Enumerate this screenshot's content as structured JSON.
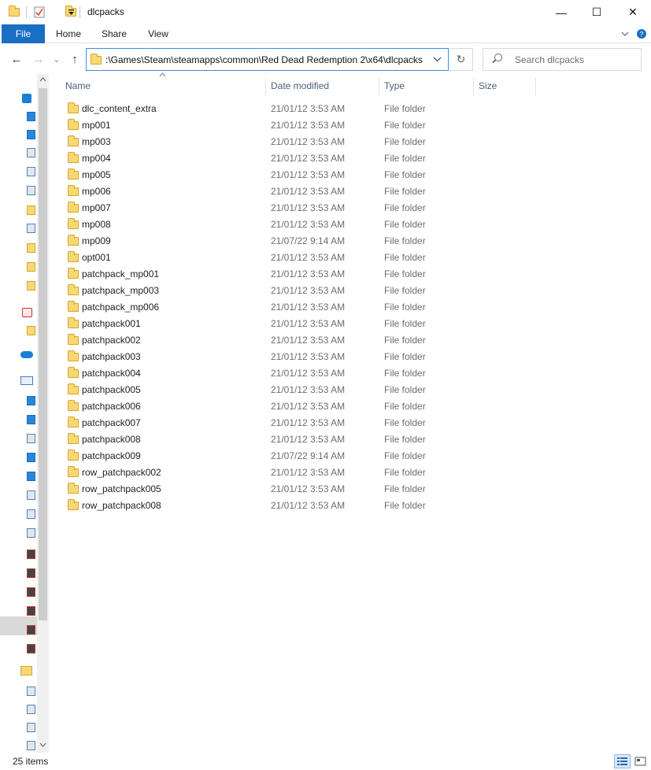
{
  "window": {
    "title": "dlcpacks",
    "controls": {
      "minimize": "—",
      "maximize": "☐",
      "close": "✕"
    }
  },
  "ribbon": {
    "tabs": [
      {
        "label": "File",
        "active": true
      },
      {
        "label": "Home"
      },
      {
        "label": "Share"
      },
      {
        "label": "View"
      }
    ],
    "expand_icon": "chevron-down-icon",
    "help_icon": "help-icon"
  },
  "navigation": {
    "back": "←",
    "forward": "→",
    "recent": "⌄",
    "up": "↑",
    "address_path": ":\\Games\\Steam\\steamapps\\common\\Red Dead Redemption 2\\x64\\dlcpacks",
    "refresh": "↻",
    "search_placeholder": "Search dlcpacks"
  },
  "columns": {
    "name": "Name",
    "date": "Date modified",
    "type": "Type",
    "size": "Size",
    "sorted_by": "Name"
  },
  "files": [
    {
      "name": "dlc_content_extra",
      "date": "21/01/12 3:53 AM",
      "type": "File folder"
    },
    {
      "name": "mp001",
      "date": "21/01/12 3:53 AM",
      "type": "File folder"
    },
    {
      "name": "mp003",
      "date": "21/01/12 3:53 AM",
      "type": "File folder"
    },
    {
      "name": "mp004",
      "date": "21/01/12 3:53 AM",
      "type": "File folder"
    },
    {
      "name": "mp005",
      "date": "21/01/12 3:53 AM",
      "type": "File folder"
    },
    {
      "name": "mp006",
      "date": "21/01/12 3:53 AM",
      "type": "File folder"
    },
    {
      "name": "mp007",
      "date": "21/01/12 3:53 AM",
      "type": "File folder"
    },
    {
      "name": "mp008",
      "date": "21/01/12 3:53 AM",
      "type": "File folder"
    },
    {
      "name": "mp009",
      "date": "21/07/22 9:14 AM",
      "type": "File folder"
    },
    {
      "name": "opt001",
      "date": "21/01/12 3:53 AM",
      "type": "File folder"
    },
    {
      "name": "patchpack_mp001",
      "date": "21/01/12 3:53 AM",
      "type": "File folder"
    },
    {
      "name": "patchpack_mp003",
      "date": "21/01/12 3:53 AM",
      "type": "File folder"
    },
    {
      "name": "patchpack_mp006",
      "date": "21/01/12 3:53 AM",
      "type": "File folder"
    },
    {
      "name": "patchpack001",
      "date": "21/01/12 3:53 AM",
      "type": "File folder"
    },
    {
      "name": "patchpack002",
      "date": "21/01/12 3:53 AM",
      "type": "File folder"
    },
    {
      "name": "patchpack003",
      "date": "21/01/12 3:53 AM",
      "type": "File folder"
    },
    {
      "name": "patchpack004",
      "date": "21/01/12 3:53 AM",
      "type": "File folder"
    },
    {
      "name": "patchpack005",
      "date": "21/01/12 3:53 AM",
      "type": "File folder"
    },
    {
      "name": "patchpack006",
      "date": "21/01/12 3:53 AM",
      "type": "File folder"
    },
    {
      "name": "patchpack007",
      "date": "21/01/12 3:53 AM",
      "type": "File folder"
    },
    {
      "name": "patchpack008",
      "date": "21/01/12 3:53 AM",
      "type": "File folder"
    },
    {
      "name": "patchpack009",
      "date": "21/07/22 9:14 AM",
      "type": "File folder"
    },
    {
      "name": "row_patchpack002",
      "date": "21/01/12 3:53 AM",
      "type": "File folder"
    },
    {
      "name": "row_patchpack005",
      "date": "21/01/12 3:53 AM",
      "type": "File folder"
    },
    {
      "name": "row_patchpack008",
      "date": "21/01/12 3:53 AM",
      "type": "File folder"
    }
  ],
  "status": {
    "item_count": "25 items",
    "view_modes": [
      "details-view-icon",
      "large-icons-view-icon"
    ],
    "active_view": "details-view-icon"
  },
  "nav_pane_icons": [
    "quick-access-star-icon",
    "desktop-icon",
    "downloads-icon",
    "documents-icon",
    "network-drive-icon",
    "pictures-icon",
    "folder-icon",
    "documents-icon",
    "folder-icon",
    "folder-icon",
    "folder-icon",
    "creative-cloud-icon",
    "folder-icon",
    "onedrive-icon",
    "this-pc-icon",
    "3d-objects-icon",
    "desktop-icon",
    "documents-icon",
    "downloads-icon",
    "music-icon",
    "pictures-icon",
    "videos-icon",
    "local-disk-icon",
    "drive-icon",
    "drive-icon",
    "drive-icon",
    "drive-icon",
    "drive-icon",
    "drive-icon",
    "libraries-icon",
    "network-computer-icon",
    "network-computer-icon",
    "network-computer-icon",
    "network-computer-icon"
  ],
  "colors": {
    "accent": "#1a6ec4",
    "folder": "#f8d775",
    "header_text": "#4c607a",
    "secondary_text": "#6d6d6d"
  }
}
